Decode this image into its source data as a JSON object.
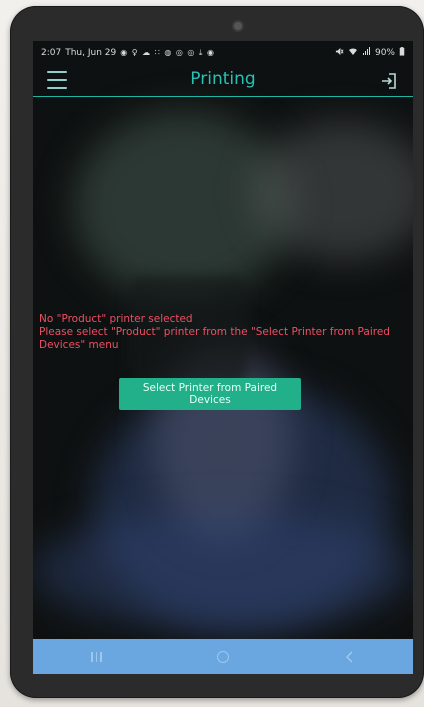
{
  "status_bar": {
    "time": "2:07",
    "date": "Thu, Jun 29",
    "battery": "90%",
    "notification_icons": "◉ ♀ ☁ ∷ ◍ ◎ ◎ ⤓ ◉"
  },
  "app_bar": {
    "title": "Printing"
  },
  "message": {
    "line1": "No \"Product\" printer selected",
    "line2": "Please select \"Product\" printer from the \"Select Printer from Paired Devices\" menu"
  },
  "button": {
    "label": "Select Printer from Paired Devices"
  },
  "colors": {
    "accent": "#27c2b5",
    "error": "#ee4f63",
    "button": "#21b08a",
    "nav_bar": "#6aa7e0"
  },
  "icons": {
    "menu": "hamburger-menu-icon",
    "logout": "logout-icon",
    "recents": "recents-icon",
    "home": "home-icon",
    "back": "back-icon"
  }
}
